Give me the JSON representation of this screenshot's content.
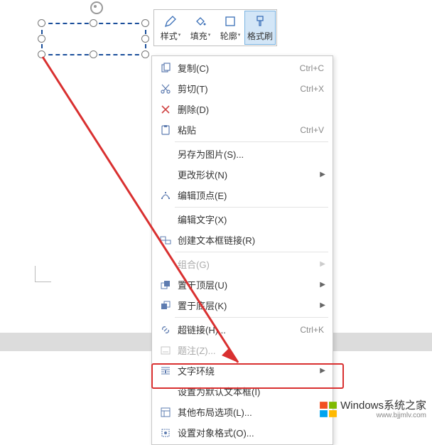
{
  "toolbar": {
    "style": "样式",
    "fill": "填充",
    "outline": "轮廓",
    "format_painter": "格式刷"
  },
  "menu": {
    "copy": {
      "label": "复制(C)",
      "shortcut": "Ctrl+C"
    },
    "cut": {
      "label": "剪切(T)",
      "shortcut": "Ctrl+X"
    },
    "delete": {
      "label": "删除(D)"
    },
    "paste": {
      "label": "粘贴",
      "shortcut": "Ctrl+V"
    },
    "save_as_picture": {
      "label": "另存为图片(S)..."
    },
    "change_shape": {
      "label": "更改形状(N)"
    },
    "edit_points": {
      "label": "编辑顶点(E)"
    },
    "edit_text": {
      "label": "编辑文字(X)"
    },
    "create_textbox_link": {
      "label": "创建文本框链接(R)"
    },
    "group": {
      "label": "组合(G)"
    },
    "bring_to_front": {
      "label": "置于顶层(U)"
    },
    "send_to_back": {
      "label": "置于底层(K)"
    },
    "hyperlink": {
      "label": "超链接(H)...",
      "shortcut": "Ctrl+K"
    },
    "caption": {
      "label": "题注(Z)..."
    },
    "text_wrapping": {
      "label": "文字环绕"
    },
    "set_default_textbox": {
      "label": "设置为默认文本框(I)"
    },
    "more_layout_options": {
      "label": "其他布局选项(L)..."
    },
    "format_object": {
      "label": "设置对象格式(O)..."
    }
  },
  "watermark": {
    "main": "Windows系统之家",
    "sub": "www.bjjmlv.com"
  }
}
